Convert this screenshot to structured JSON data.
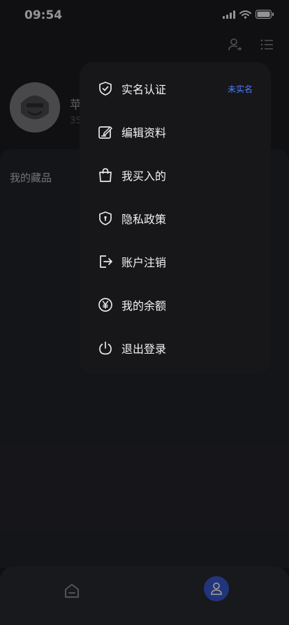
{
  "status_bar": {
    "time": "09:54"
  },
  "profile": {
    "name": "苹",
    "sub": "35"
  },
  "section": {
    "title": "我的藏品"
  },
  "menu": {
    "items": [
      {
        "label": "实名认证",
        "icon": "shield-check-icon",
        "badge": "未实名"
      },
      {
        "label": "编辑资料",
        "icon": "edit-icon"
      },
      {
        "label": "我买入的",
        "icon": "shopping-bag-icon"
      },
      {
        "label": "隐私政策",
        "icon": "privacy-shield-icon"
      },
      {
        "label": "账户注销",
        "icon": "logout-icon"
      },
      {
        "label": "我的余额",
        "icon": "yen-icon"
      },
      {
        "label": "退出登录",
        "icon": "power-icon"
      }
    ]
  },
  "colors": {
    "background": "#1c1d22",
    "menu_bg": "#17171a",
    "accent": "#4a7cff",
    "tab_active": "#3b5bd6"
  }
}
